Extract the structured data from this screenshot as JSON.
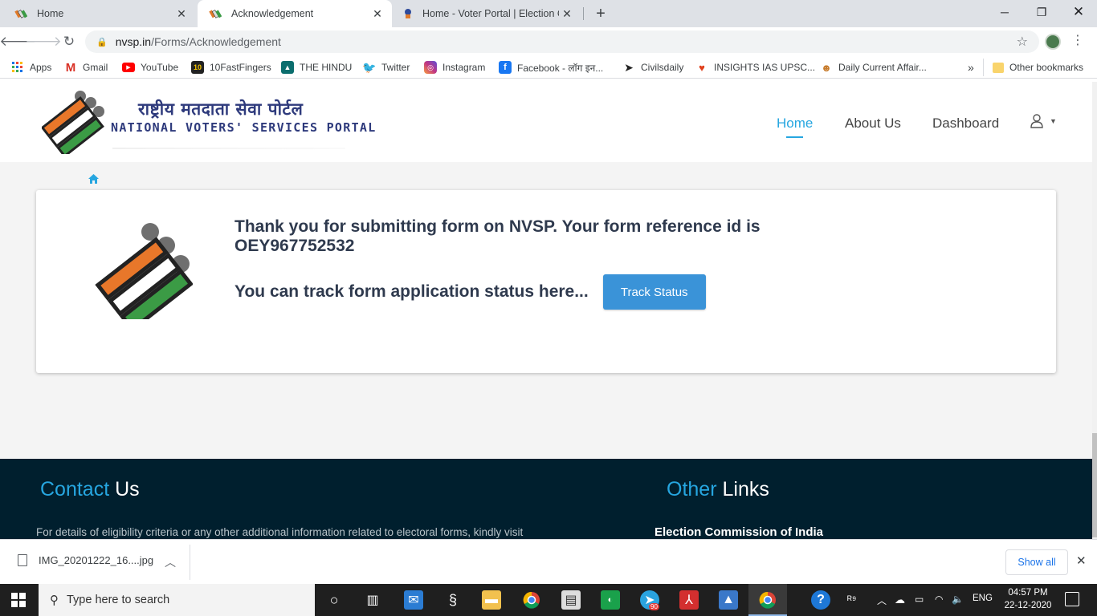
{
  "browser": {
    "tabs": [
      {
        "title": "Home",
        "icon": "nvsp-favicon"
      },
      {
        "title": "Acknowledgement",
        "icon": "nvsp-favicon"
      },
      {
        "title": "Home - Voter Portal | Election Co",
        "icon": "voter-portal-favicon"
      }
    ],
    "url_host": "nvsp.in",
    "url_path": "/Forms/Acknowledgement"
  },
  "bookmarks": {
    "items": [
      {
        "label": "Apps",
        "icon": "apps-grid-icon",
        "color": "#1a73e8"
      },
      {
        "label": "Gmail",
        "icon": "gmail-icon",
        "color": "#d93025"
      },
      {
        "label": "YouTube",
        "icon": "youtube-icon",
        "color": "#ff0000"
      },
      {
        "label": "10FastFingers",
        "icon": "10fastfingers-icon",
        "color": "#222222"
      },
      {
        "label": "THE HINDU",
        "icon": "the-hindu-icon",
        "color": "#0b6e6e"
      },
      {
        "label": "Twitter",
        "icon": "twitter-icon",
        "color": "#1da1f2"
      },
      {
        "label": "Instagram",
        "icon": "instagram-icon",
        "color": "#c13584"
      },
      {
        "label": "Facebook - लॉग इन...",
        "icon": "facebook-icon",
        "color": "#1877f2"
      },
      {
        "label": "Civilsdaily",
        "icon": "civilsdaily-icon",
        "color": "#222222"
      },
      {
        "label": "INSIGHTS IAS UPSC...",
        "icon": "insights-ias-icon",
        "color": "#e0401c"
      },
      {
        "label": "Daily Current Affair...",
        "icon": "daily-current-affairs-icon",
        "color": "#c77b2b"
      }
    ],
    "overflow": "»",
    "other": "Other bookmarks"
  },
  "site": {
    "logo_hindi": "राष्ट्रीय मतदाता सेवा पोर्टल",
    "logo_english": "NATIONAL VOTERS' SERVICES PORTAL",
    "nav": {
      "home": "Home",
      "about": "About Us",
      "dashboard": "Dashboard"
    },
    "accent": "#26a6e0"
  },
  "acknowledgement": {
    "message": "Thank you for submitting form on NVSP. Your form reference id is OEY967752532",
    "track_text": "You can track form application status here...",
    "track_button": "Track Status"
  },
  "footer": {
    "contact_accent": "Contact",
    "contact_rest": "Us",
    "links_accent": "Other",
    "links_rest": "Links",
    "contact_text": "For details of eligibility criteria or any other additional information related to electoral forms, kindly visit",
    "first_link": "Election Commission of India",
    "bg": "#001f2e"
  },
  "downloads": {
    "file": "IMG_20201222_16....jpg",
    "show_all": "Show all"
  },
  "taskbar": {
    "search_placeholder": "Type here to search",
    "lang": "ENG",
    "time": "04:57 PM",
    "date": "22-12-2020",
    "telegram_badge": "90"
  }
}
